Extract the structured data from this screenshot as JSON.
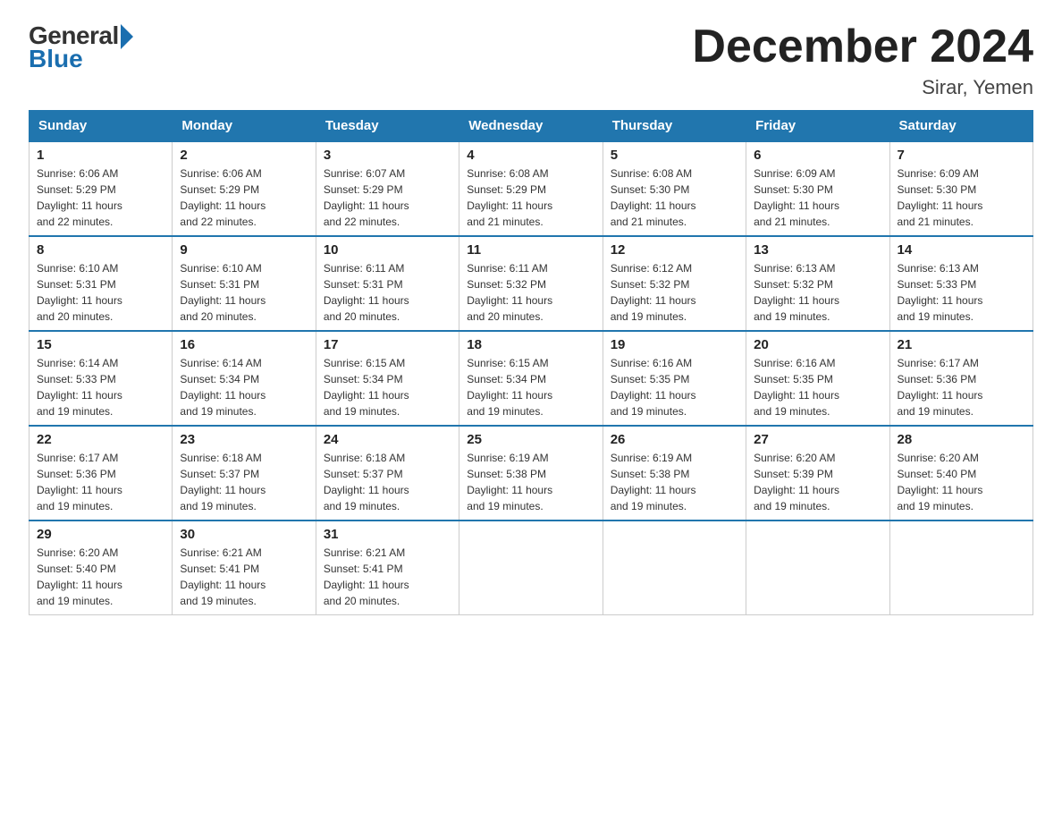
{
  "logo": {
    "general": "General",
    "blue": "Blue"
  },
  "header": {
    "title": "December 2024",
    "subtitle": "Sirar, Yemen"
  },
  "weekdays": [
    "Sunday",
    "Monday",
    "Tuesday",
    "Wednesday",
    "Thursday",
    "Friday",
    "Saturday"
  ],
  "weeks": [
    [
      {
        "day": "1",
        "sunrise": "6:06 AM",
        "sunset": "5:29 PM",
        "daylight": "11 hours and 22 minutes."
      },
      {
        "day": "2",
        "sunrise": "6:06 AM",
        "sunset": "5:29 PM",
        "daylight": "11 hours and 22 minutes."
      },
      {
        "day": "3",
        "sunrise": "6:07 AM",
        "sunset": "5:29 PM",
        "daylight": "11 hours and 22 minutes."
      },
      {
        "day": "4",
        "sunrise": "6:08 AM",
        "sunset": "5:29 PM",
        "daylight": "11 hours and 21 minutes."
      },
      {
        "day": "5",
        "sunrise": "6:08 AM",
        "sunset": "5:30 PM",
        "daylight": "11 hours and 21 minutes."
      },
      {
        "day": "6",
        "sunrise": "6:09 AM",
        "sunset": "5:30 PM",
        "daylight": "11 hours and 21 minutes."
      },
      {
        "day": "7",
        "sunrise": "6:09 AM",
        "sunset": "5:30 PM",
        "daylight": "11 hours and 21 minutes."
      }
    ],
    [
      {
        "day": "8",
        "sunrise": "6:10 AM",
        "sunset": "5:31 PM",
        "daylight": "11 hours and 20 minutes."
      },
      {
        "day": "9",
        "sunrise": "6:10 AM",
        "sunset": "5:31 PM",
        "daylight": "11 hours and 20 minutes."
      },
      {
        "day": "10",
        "sunrise": "6:11 AM",
        "sunset": "5:31 PM",
        "daylight": "11 hours and 20 minutes."
      },
      {
        "day": "11",
        "sunrise": "6:11 AM",
        "sunset": "5:32 PM",
        "daylight": "11 hours and 20 minutes."
      },
      {
        "day": "12",
        "sunrise": "6:12 AM",
        "sunset": "5:32 PM",
        "daylight": "11 hours and 19 minutes."
      },
      {
        "day": "13",
        "sunrise": "6:13 AM",
        "sunset": "5:32 PM",
        "daylight": "11 hours and 19 minutes."
      },
      {
        "day": "14",
        "sunrise": "6:13 AM",
        "sunset": "5:33 PM",
        "daylight": "11 hours and 19 minutes."
      }
    ],
    [
      {
        "day": "15",
        "sunrise": "6:14 AM",
        "sunset": "5:33 PM",
        "daylight": "11 hours and 19 minutes."
      },
      {
        "day": "16",
        "sunrise": "6:14 AM",
        "sunset": "5:34 PM",
        "daylight": "11 hours and 19 minutes."
      },
      {
        "day": "17",
        "sunrise": "6:15 AM",
        "sunset": "5:34 PM",
        "daylight": "11 hours and 19 minutes."
      },
      {
        "day": "18",
        "sunrise": "6:15 AM",
        "sunset": "5:34 PM",
        "daylight": "11 hours and 19 minutes."
      },
      {
        "day": "19",
        "sunrise": "6:16 AM",
        "sunset": "5:35 PM",
        "daylight": "11 hours and 19 minutes."
      },
      {
        "day": "20",
        "sunrise": "6:16 AM",
        "sunset": "5:35 PM",
        "daylight": "11 hours and 19 minutes."
      },
      {
        "day": "21",
        "sunrise": "6:17 AM",
        "sunset": "5:36 PM",
        "daylight": "11 hours and 19 minutes."
      }
    ],
    [
      {
        "day": "22",
        "sunrise": "6:17 AM",
        "sunset": "5:36 PM",
        "daylight": "11 hours and 19 minutes."
      },
      {
        "day": "23",
        "sunrise": "6:18 AM",
        "sunset": "5:37 PM",
        "daylight": "11 hours and 19 minutes."
      },
      {
        "day": "24",
        "sunrise": "6:18 AM",
        "sunset": "5:37 PM",
        "daylight": "11 hours and 19 minutes."
      },
      {
        "day": "25",
        "sunrise": "6:19 AM",
        "sunset": "5:38 PM",
        "daylight": "11 hours and 19 minutes."
      },
      {
        "day": "26",
        "sunrise": "6:19 AM",
        "sunset": "5:38 PM",
        "daylight": "11 hours and 19 minutes."
      },
      {
        "day": "27",
        "sunrise": "6:20 AM",
        "sunset": "5:39 PM",
        "daylight": "11 hours and 19 minutes."
      },
      {
        "day": "28",
        "sunrise": "6:20 AM",
        "sunset": "5:40 PM",
        "daylight": "11 hours and 19 minutes."
      }
    ],
    [
      {
        "day": "29",
        "sunrise": "6:20 AM",
        "sunset": "5:40 PM",
        "daylight": "11 hours and 19 minutes."
      },
      {
        "day": "30",
        "sunrise": "6:21 AM",
        "sunset": "5:41 PM",
        "daylight": "11 hours and 19 minutes."
      },
      {
        "day": "31",
        "sunrise": "6:21 AM",
        "sunset": "5:41 PM",
        "daylight": "11 hours and 20 minutes."
      },
      null,
      null,
      null,
      null
    ]
  ],
  "labels": {
    "sunrise": "Sunrise:",
    "sunset": "Sunset:",
    "daylight": "Daylight:"
  }
}
